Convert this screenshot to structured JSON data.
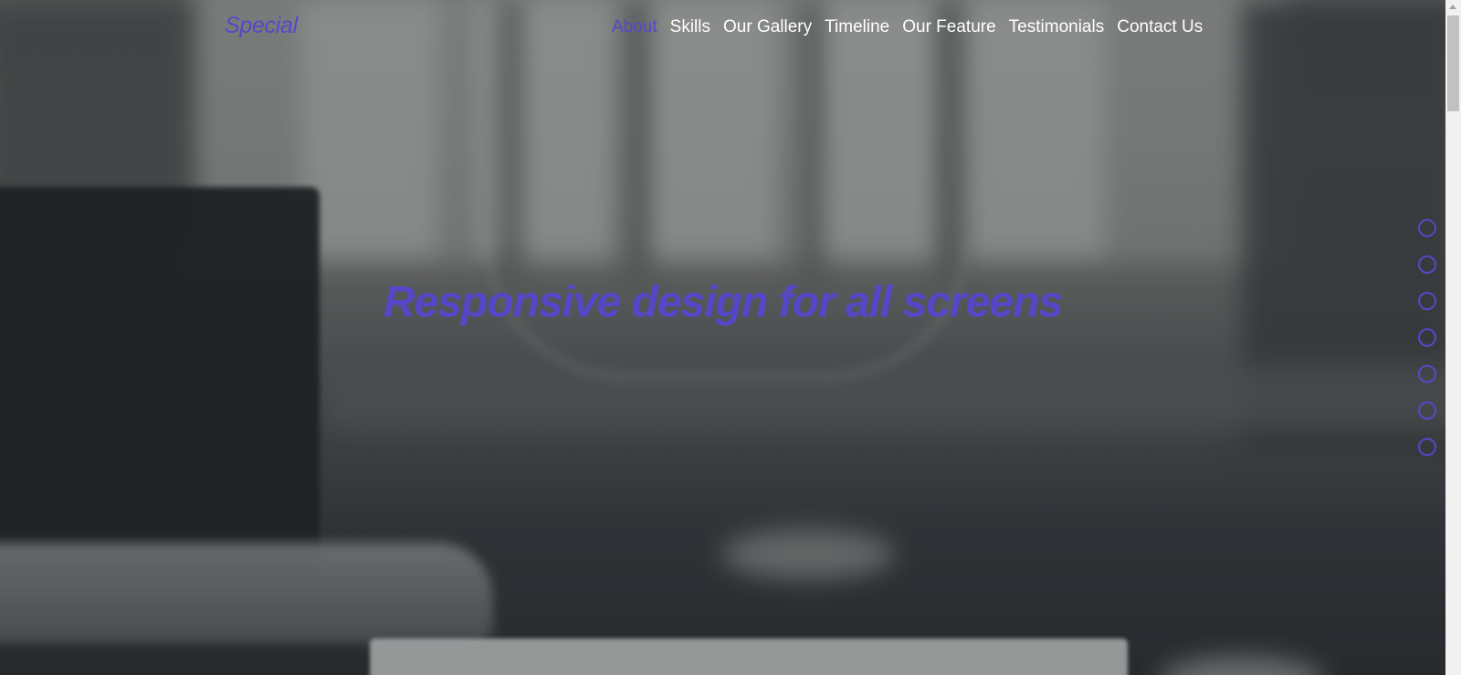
{
  "nav": {
    "brand": "Special",
    "items": [
      {
        "label": "About",
        "active": true
      },
      {
        "label": "Skills",
        "active": false
      },
      {
        "label": "Our Gallery",
        "active": false
      },
      {
        "label": "Timeline",
        "active": false
      },
      {
        "label": "Our Feature",
        "active": false
      },
      {
        "label": "Testimonials",
        "active": false
      },
      {
        "label": "Contact Us",
        "active": false
      }
    ]
  },
  "hero": {
    "title": "Responsive design for all screens"
  },
  "bullets": {
    "count": 7,
    "color": "#5548c8"
  },
  "colors": {
    "accent": "#5548c8",
    "nav_text": "#ffffff"
  }
}
